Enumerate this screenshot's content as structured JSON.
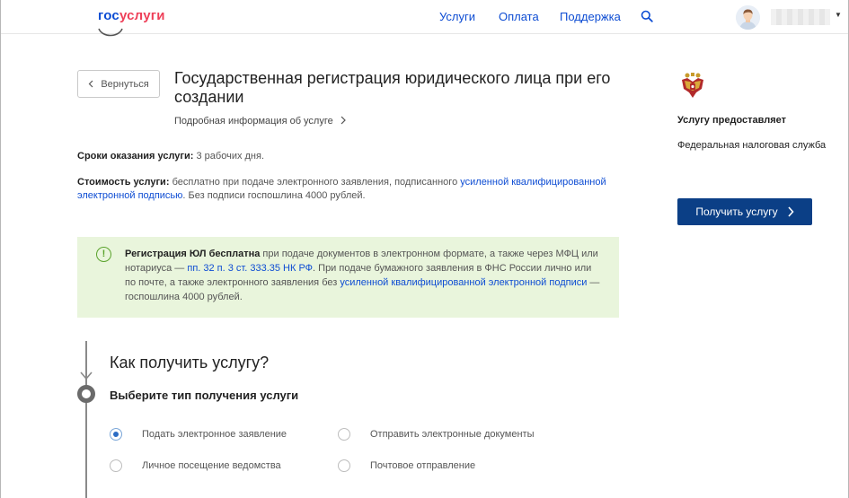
{
  "header": {
    "logo_part1": "гос",
    "logo_part2": "услуги",
    "nav": [
      "Услуги",
      "Оплата",
      "Поддержка"
    ],
    "search_icon": "search-icon",
    "avatar_icon": "user-avatar",
    "dropdown_icon": "caret-down-icon"
  },
  "back_button": {
    "label": "Вернуться",
    "icon": "chevron-left-icon"
  },
  "service": {
    "title": "Государственная регистрация юридического лица при его создании",
    "more_info": "Подробная информация об услуге",
    "more_info_icon": "chevron-right-icon"
  },
  "terms": {
    "label": "Сроки оказания услуги:",
    "value": "3 рабочих дня."
  },
  "cost": {
    "label": "Стоимость услуги:",
    "text_before": "бесплатно при подаче электронного заявления, подписанного",
    "link": "усиленной квалифицированной электронной подписью",
    "text_after": ". Без подписи госпошлина 4000 рублей."
  },
  "notice": {
    "icon": "exclamation-circle-icon",
    "bold": "Регистрация ЮЛ бесплатна",
    "text1": "при подаче документов в электронном формате, а также через МФЦ или нотариуса —",
    "link1": "пп. 32 п. 3 ст. 333.35 НК РФ",
    "text2": ". При подаче бумажного заявления в ФНС России лично или по почте, а также электронного заявления без",
    "link2": "усиленной квалифицированной электронной подписи",
    "text3": "— госпошлина 4000 рублей."
  },
  "how_to": {
    "title": "Как получить услугу?",
    "step_title": "Выберите тип получения услуги",
    "options": [
      {
        "label": "Подать электронное заявление",
        "checked": true
      },
      {
        "label": "Отправить электронные документы",
        "checked": false
      },
      {
        "label": "Личное посещение ведомства",
        "checked": false
      },
      {
        "label": "Почтовое отправление",
        "checked": false
      }
    ]
  },
  "provider": {
    "emblem_icon": "russian-coat-of-arms-icon",
    "heading": "Услугу предоставляет",
    "name": "Федеральная налоговая служба"
  },
  "cta": {
    "label": "Получить услугу",
    "icon": "chevron-right-icon"
  },
  "colors": {
    "brand_blue": "#0d4cd3",
    "brand_red": "#ee3f58",
    "cta_blue": "#0b3f86",
    "notice_bg": "#e9f5dc",
    "notice_accent": "#5aa32c"
  }
}
